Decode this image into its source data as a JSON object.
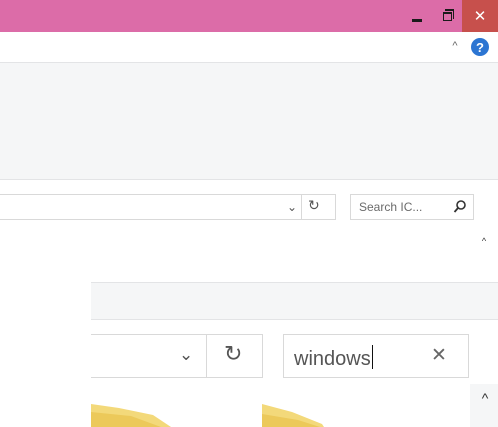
{
  "window": {
    "titlebar_color": "#dc6ca8",
    "close_hover_color": "#c7504c",
    "minimize_icon": "minimize-icon",
    "restore_icon": "restore-icon",
    "close_icon": "close-icon",
    "close_glyph": "✕"
  },
  "ribbon": {
    "collapse_glyph": "^",
    "help_glyph": "?"
  },
  "navbar_small": {
    "dropdown_glyph": "⌄",
    "refresh_glyph": "↻",
    "search_placeholder": "Search IC...",
    "scroll_up_glyph": "^"
  },
  "navbar_zoomed": {
    "dropdown_glyph": "⌄",
    "refresh_glyph": "↻",
    "search_value": "windows",
    "clear_glyph": "✕",
    "scroll_up_glyph": "^"
  },
  "colors": {
    "help_blue": "#2c75d2",
    "folder_yellow": "#f3d97a"
  }
}
